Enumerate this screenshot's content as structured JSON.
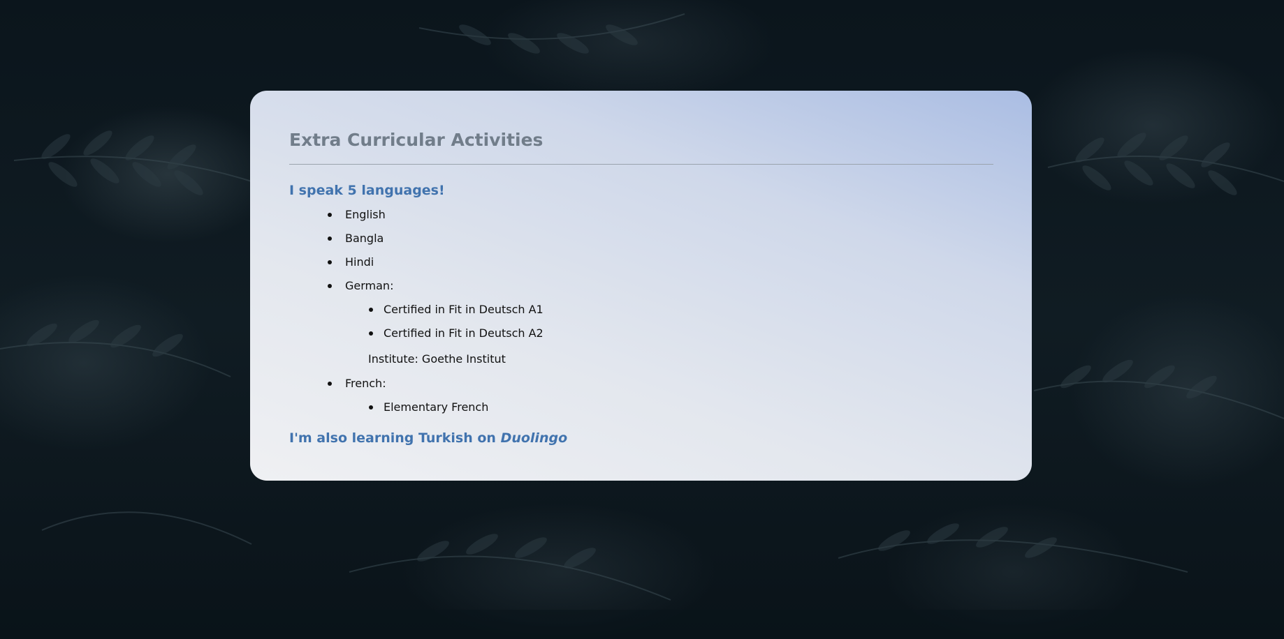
{
  "card": {
    "title": "Extra Curricular Activities",
    "languages_heading": "I speak 5 languages!",
    "languages": [
      {
        "label": "English"
      },
      {
        "label": "Bangla"
      },
      {
        "label": "Hindi"
      },
      {
        "label": "German:",
        "sub_items": [
          "Certified in Fit in Deutsch A1",
          "Certified in Fit in Deutsch A2"
        ],
        "note": "Institute: Goethe Institut"
      },
      {
        "label": "French:",
        "sub_items": [
          "Elementary French"
        ]
      }
    ],
    "closing_text": "I'm also learning Turkish on",
    "closing_app": "Duolingo"
  },
  "colors": {
    "title": "#717d8a",
    "heading_accent": "#4173ae",
    "card_gradient_start": "#eff0f3",
    "card_gradient_end": "#aabde3",
    "page_background": "#0c161d"
  },
  "background": {
    "icon": "fern-leaves-photo"
  }
}
